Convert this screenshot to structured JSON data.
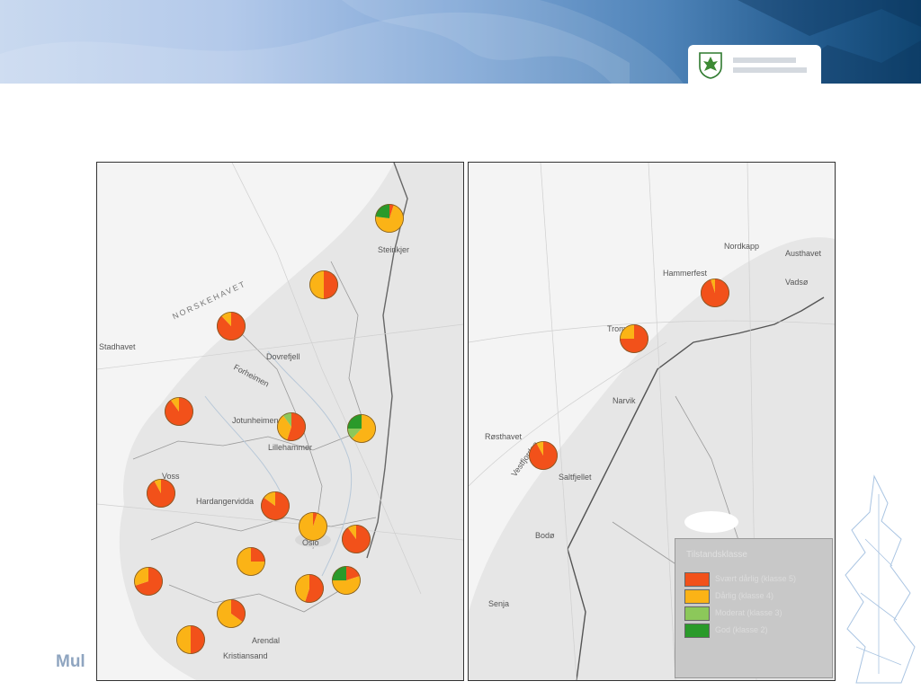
{
  "colors": {
    "red": "#f2511a",
    "orange": "#fbb316",
    "light_green": "#8cc85a",
    "dark_green": "#2a9a2a",
    "banner_dark": "#0f4470",
    "land": "#e6e6e6",
    "sea": "#f4f4f4"
  },
  "header": {
    "logo_icon": "coat-of-arms-icon"
  },
  "left_map": {
    "labels": {
      "sea_north": "NORSKEHAVET",
      "stadhavet": "Stadhavet",
      "steinkjer": "Steinkjer",
      "dovrefjell": "Dovrefjell",
      "jotunheimen": "Jotunheimen",
      "lillehammer": "Lillehammer",
      "voss": "Voss",
      "vidda": "Hardangervidda",
      "oslo": "Oslo",
      "arendal": "Arendal",
      "kristiansand": "Kristiansand",
      "forhonn": "Forheimen"
    },
    "pies": [
      {
        "name": "pie-steinkjer",
        "slices": [
          0.05,
          0.72,
          0.0,
          0.23
        ]
      },
      {
        "name": "pie-trondheim",
        "slices": [
          0.5,
          0.5,
          0.0,
          0.0
        ]
      },
      {
        "name": "pie-molde",
        "slices": [
          0.88,
          0.12,
          0.0,
          0.0
        ]
      },
      {
        "name": "pie-sogn",
        "slices": [
          0.9,
          0.1,
          0.0,
          0.0
        ]
      },
      {
        "name": "pie-lillehammer",
        "slices": [
          0.55,
          0.35,
          0.1,
          0.0
        ]
      },
      {
        "name": "pie-hamar",
        "slices": [
          0.0,
          0.62,
          0.13,
          0.25
        ]
      },
      {
        "name": "pie-voss",
        "slices": [
          0.92,
          0.08,
          0.0,
          0.0
        ]
      },
      {
        "name": "pie-hallingdal",
        "slices": [
          0.85,
          0.15,
          0.0,
          0.0
        ]
      },
      {
        "name": "pie-oslo",
        "slices": [
          0.05,
          0.95,
          0.0,
          0.0
        ]
      },
      {
        "name": "pie-ostfold-north",
        "slices": [
          0.9,
          0.1,
          0.0,
          0.0
        ]
      },
      {
        "name": "pie-telemark",
        "slices": [
          0.25,
          0.75,
          0.0,
          0.0
        ]
      },
      {
        "name": "pie-rogaland",
        "slices": [
          0.7,
          0.3,
          0.0,
          0.0
        ]
      },
      {
        "name": "pie-vestfold",
        "slices": [
          0.55,
          0.45,
          0.0,
          0.0
        ]
      },
      {
        "name": "pie-ostfold",
        "slices": [
          0.2,
          0.55,
          0.0,
          0.25
        ]
      },
      {
        "name": "pie-setesdal",
        "slices": [
          0.35,
          0.65,
          0.0,
          0.0
        ]
      },
      {
        "name": "pie-agder",
        "slices": [
          0.5,
          0.5,
          0.0,
          0.0
        ]
      }
    ]
  },
  "right_map": {
    "labels": {
      "nordkapp": "Nordkapp",
      "austhavet": "Austhavet",
      "hammerfest": "Hammerfest",
      "vadso": "Vadsø",
      "tromso": "Tromsø",
      "narvik": "Narvik",
      "rosthavet": "Røsthavet",
      "vestfjorden": "Vestfjorden",
      "saltfjellet": "Saltfjellet",
      "bodo": "Bodø",
      "senja": "Senja"
    },
    "pies": [
      {
        "name": "pie-finnmark",
        "slices": [
          0.95,
          0.05,
          0.0,
          0.0
        ]
      },
      {
        "name": "pie-troms",
        "slices": [
          0.75,
          0.25,
          0.0,
          0.0
        ]
      },
      {
        "name": "pie-nordland",
        "slices": [
          0.92,
          0.08,
          0.0,
          0.0
        ]
      }
    ],
    "legend": {
      "title": "Tilstandsklasse",
      "items": [
        {
          "color": "#f2511a",
          "label": "Svært dårlig (klasse 5)"
        },
        {
          "color": "#fbb316",
          "label": "Dårlig (klasse 4)"
        },
        {
          "color": "#8cc85a",
          "label": "Moderat (klasse 3)"
        },
        {
          "color": "#2a9a2a",
          "label": "God (klasse 2)"
        }
      ]
    }
  },
  "footer": {
    "text": "Mul"
  }
}
